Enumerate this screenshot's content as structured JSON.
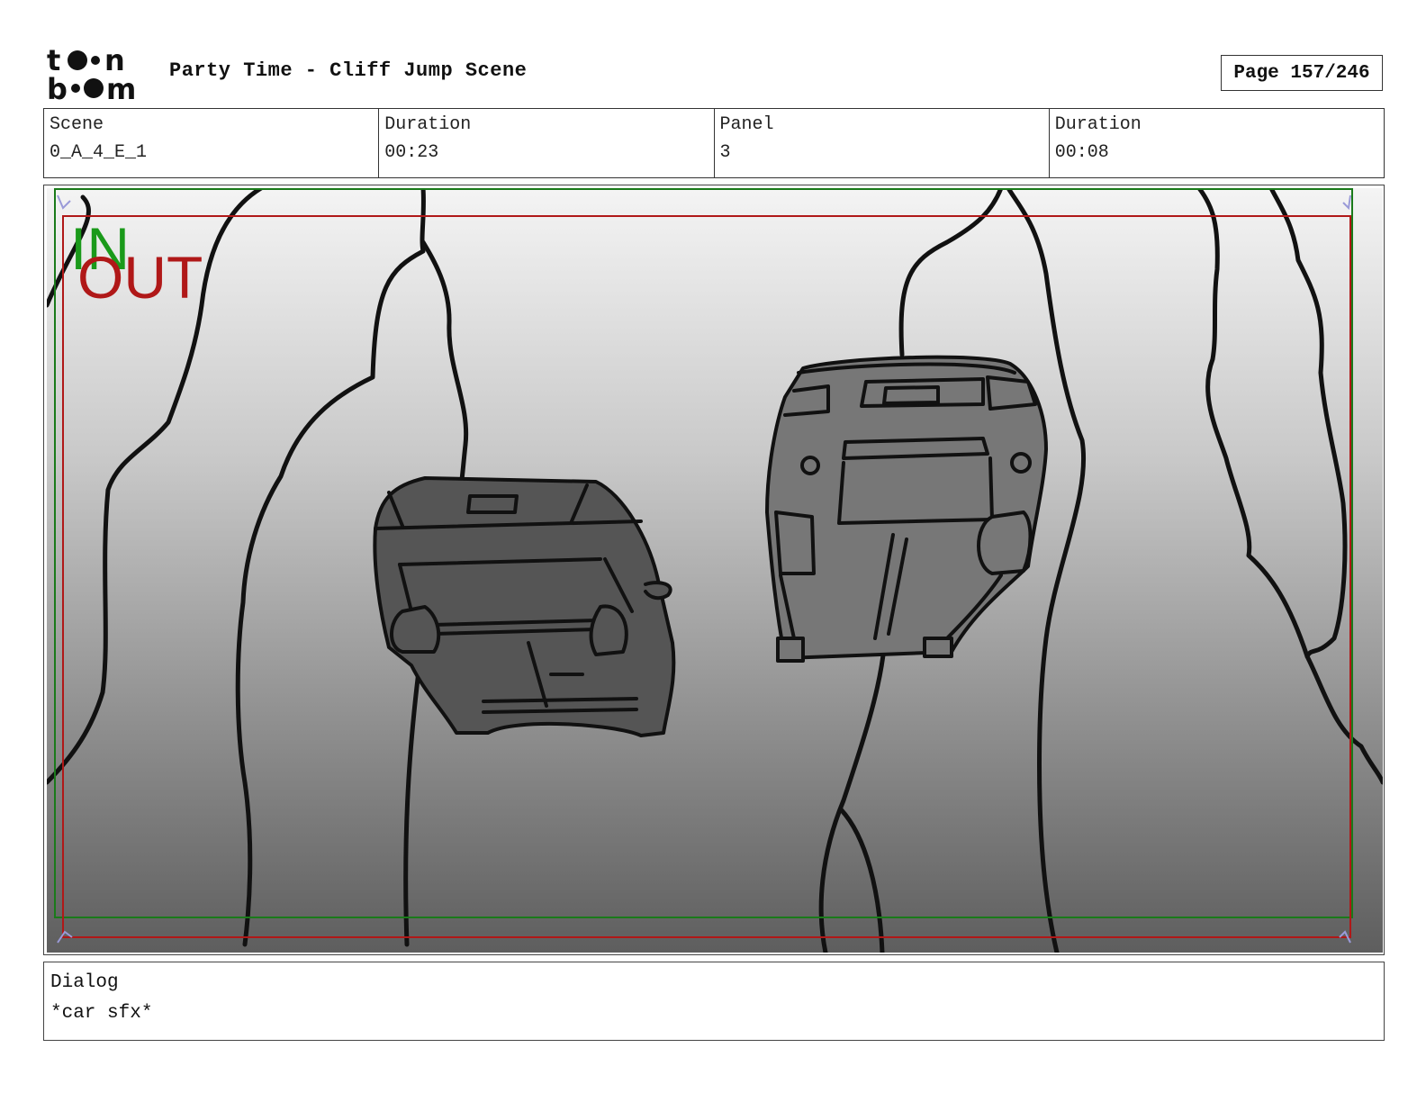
{
  "header": {
    "title": "Party Time - Cliff Jump Scene",
    "page": "Page 157/246",
    "logo_text": "toon boom"
  },
  "info": {
    "scene_label": "Scene",
    "scene_value": "0_A_4_E_1",
    "scene_duration_label": "Duration",
    "scene_duration_value": "00:23",
    "panel_label": "Panel",
    "panel_value": "3",
    "panel_duration_label": "Duration",
    "panel_duration_value": "00:08"
  },
  "panel": {
    "in_marker": "IN",
    "out_marker": "OUT",
    "in_color": "#1a9a1a",
    "out_color": "#b01818"
  },
  "dialog": {
    "label": "Dialog",
    "text": "*car sfx*"
  }
}
